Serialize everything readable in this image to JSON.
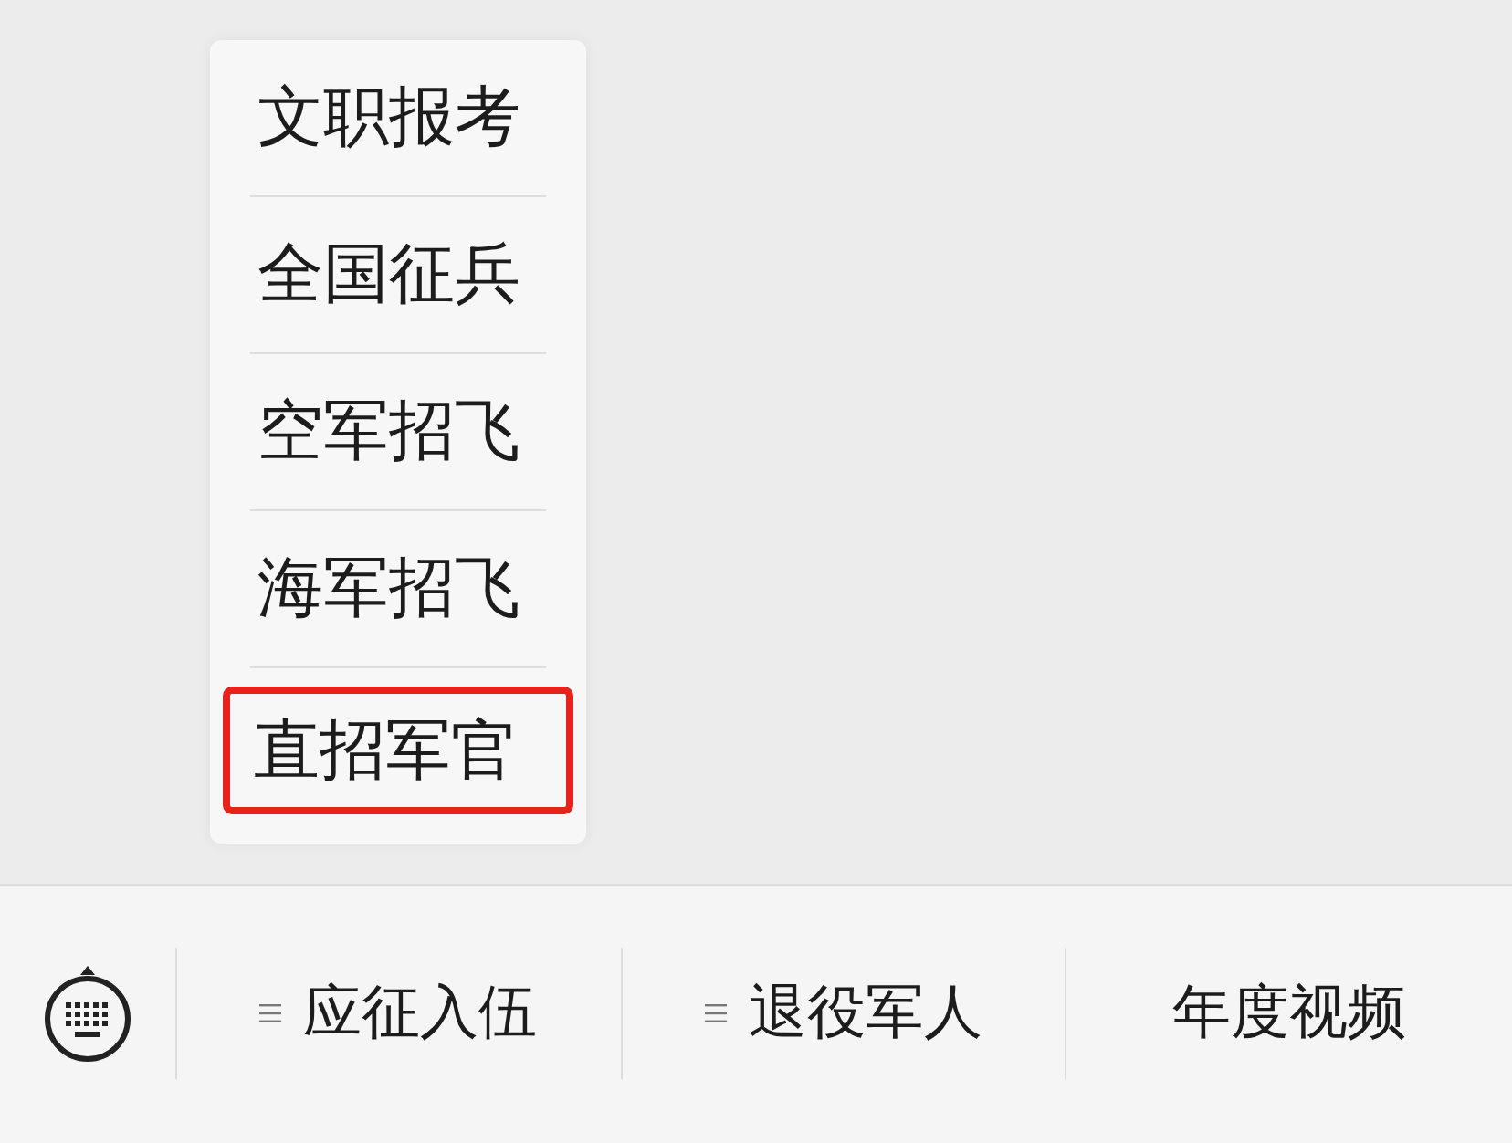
{
  "popup_menu": {
    "items": [
      {
        "label": "文职报考",
        "highlighted": false
      },
      {
        "label": "全国征兵",
        "highlighted": false
      },
      {
        "label": "空军招飞",
        "highlighted": false
      },
      {
        "label": "海军招飞",
        "highlighted": false
      },
      {
        "label": "直招军官",
        "highlighted": true
      }
    ]
  },
  "bottom_menu": {
    "items": [
      {
        "label": "应征入伍",
        "has_submenu": true
      },
      {
        "label": "退役军人",
        "has_submenu": true
      },
      {
        "label": "年度视频",
        "has_submenu": false
      }
    ]
  }
}
